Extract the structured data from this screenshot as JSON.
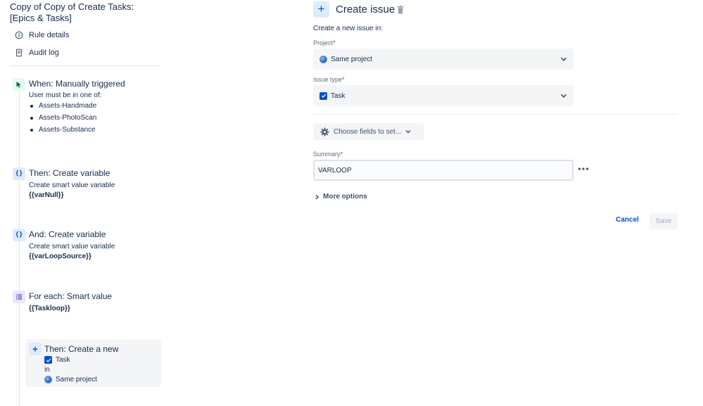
{
  "rule": {
    "title": "Copy of Copy of Create Tasks: [Epics & Tasks]"
  },
  "nav": {
    "rule_details": "Rule details",
    "audit_log": "Audit log"
  },
  "steps": {
    "trigger": {
      "title": "When: Manually triggered",
      "subtitle": "User must be in one of:",
      "groups": [
        "Assets-Handmade",
        "Assets-PhotoScan",
        "Assets-Substance"
      ]
    },
    "var1": {
      "title": "Then: Create variable",
      "subtitle": "Create smart value variable",
      "value": "{{varNull}}"
    },
    "var2": {
      "title": "And: Create variable",
      "subtitle": "Create smart value variable",
      "value": "{{varLoopSource}}"
    },
    "branch": {
      "title": "For each: Smart value",
      "value": "{{Taskloop}}"
    },
    "nested": {
      "title": "Then: Create a new",
      "issue_type": "Task",
      "in_label": "in",
      "project": "Same project"
    }
  },
  "panel": {
    "title": "Create issue",
    "intro": "Create a new issue in:",
    "project_label": "Project",
    "project_value": "Same project",
    "issue_type_label": "Issue type",
    "issue_type_value": "Task",
    "choose_fields": "Choose fields to set...",
    "summary_label": "Summary",
    "summary_value": "VARLOOP",
    "more_options": "More options",
    "cancel": "Cancel",
    "save": "Save",
    "required_mark": "*"
  },
  "colors": {
    "accent": "#0052cc",
    "trigger_icon_bg": "#e3fcef",
    "branch_icon_bg": "#eae6ff",
    "field_bg": "#f4f5f7"
  },
  "icons": {
    "rule_details": "info-icon",
    "audit_log": "document-icon",
    "trigger": "pointer-icon",
    "variable": "braces-icon",
    "branch": "list-icon",
    "action": "plus-icon",
    "project": "globe-icon",
    "issue_type": "checkbox-icon"
  }
}
